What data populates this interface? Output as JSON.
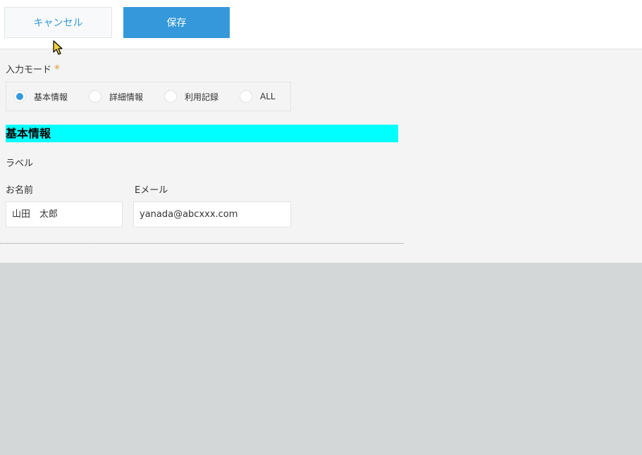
{
  "toolbar": {
    "cancel_label": "キャンセル",
    "save_label": "保存"
  },
  "form": {
    "input_mode": {
      "label": "入力モード",
      "required_mark": "*",
      "options": [
        {
          "label": "基本情報",
          "checked": true
        },
        {
          "label": "詳細情報",
          "checked": false
        },
        {
          "label": "利用記録",
          "checked": false
        },
        {
          "label": "ALL",
          "checked": false
        }
      ]
    },
    "section_title": "基本情報",
    "label_field": "ラベル",
    "name_field": {
      "label": "お名前",
      "value": "山田　太郎"
    },
    "email_field": {
      "label": "Eメール",
      "value": "yanada@abcxxx.com"
    }
  },
  "colors": {
    "accent": "#3498db",
    "section_highlight": "#00ffff",
    "required": "#e49e2f",
    "form_background": "#f4f4f4",
    "page_background": "#d3d7d8"
  }
}
